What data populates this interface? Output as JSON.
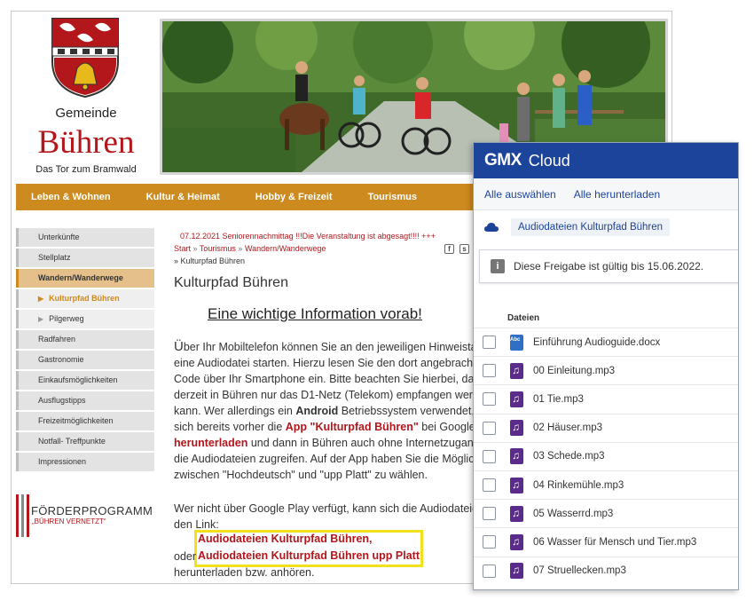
{
  "site": {
    "municipality_label": "Gemeinde",
    "municipality_name": "Bühren",
    "tagline": "Das Tor zum Bramwald",
    "nav": [
      "Leben & Wohnen",
      "Kultur & Heimat",
      "Hobby & Freizeit",
      "Tourismus"
    ],
    "sidebar": [
      {
        "label": "Unterkünfte",
        "state": "normal"
      },
      {
        "label": "Stellplatz",
        "state": "normal"
      },
      {
        "label": "Wandern/Wanderwege",
        "state": "active"
      },
      {
        "label": "Kulturpfad Bühren",
        "state": "sub-current"
      },
      {
        "label": "Pilgerweg",
        "state": "sub"
      },
      {
        "label": "Radfahren",
        "state": "normal"
      },
      {
        "label": "Gastronomie",
        "state": "normal"
      },
      {
        "label": "Einkaufsmöglichkeiten",
        "state": "normal"
      },
      {
        "label": "Ausflugstipps",
        "state": "normal"
      },
      {
        "label": "Freizeitmöglichkeiten",
        "state": "normal"
      },
      {
        "label": "Notfall- Treffpunkte",
        "state": "normal"
      },
      {
        "label": "Impressionen",
        "state": "normal"
      }
    ],
    "foerder_title": "FÖRDERPROGRAMM",
    "foerder_sub": "„BÜHREN VERNETZT“",
    "ticker": "07.12.2021 Seniorennachmittag !!!Die Veranstaltung ist abgesagt!!!!  +++",
    "breadcrumb": [
      "Start",
      "Tourismus",
      "Wandern/Wanderwege"
    ],
    "breadcrumb_current": "Kulturpfad Bühren",
    "page_title": "Kulturpfad Bühren",
    "subheading": "Eine wichtige Information vorab!",
    "para1": {
      "first_letter": "Ü",
      "l1": "ber Ihr Mobiltelefon können Sie an den jeweiligen Hinweistaf",
      "l2": "eine Audiodatei starten. Hierzu lesen Sie den dort angebrachte",
      "l3": "Code über Ihr Smartphone ein. Bitte beachten Sie hierbei, das",
      "l4": "derzeit in Bühren nur das D1-Netz (Telekom) empfangen werde",
      "l5a": "kann. Wer allerdings ein ",
      "l5b": "Android",
      "l5c": " Betriebssystem verwendet, k",
      "l6a": "sich bereits vorher die ",
      "l6b": "App \"Kulturpfad Bühren\"",
      "l6c": " bei  Google",
      "l7a": "herunterladen",
      "l7b": " und dann in Bühren auch ohne Internetzugang",
      "l8": "die Audiodateien zugreifen. Auf der App haben Sie die Möglich",
      "l9": "zwischen \"Hochdeutsch\" und \"upp Platt\" zu wählen."
    },
    "para2_l1": "Wer nicht über Google Play verfügt, kann sich die Audiodateien",
    "para2_l2": "den Link:",
    "link1": "Audiodateien Kulturpfad Bühren,",
    "oder": "oder",
    "link2": "Audiodateien Kulturpfad Bühren upp Platt",
    "para3": "herunterladen bzw. anhören."
  },
  "gmx": {
    "brand": "GMX",
    "product": "Cloud",
    "select_all": "Alle auswählen",
    "download_all": "Alle herunterladen",
    "folder": "Audiodateien Kulturpfad Bühren",
    "validity_note": "Diese Freigabe ist gültig bis 15.06.2022.",
    "files_label": "Dateien",
    "files": [
      {
        "name": "Einführung Audioguide.docx",
        "type": "doc"
      },
      {
        "name": "00 Einleitung.mp3",
        "type": "audio"
      },
      {
        "name": "01 Tie.mp3",
        "type": "audio"
      },
      {
        "name": "02 Häuser.mp3",
        "type": "audio"
      },
      {
        "name": "03 Schede.mp3",
        "type": "audio"
      },
      {
        "name": "04 Rinkemühle.mp3",
        "type": "audio"
      },
      {
        "name": "05 Wasserrd.mp3",
        "type": "audio"
      },
      {
        "name": "06 Wasser für Mensch und Tier.mp3",
        "type": "audio"
      },
      {
        "name": "07 Struellecken.mp3",
        "type": "audio"
      }
    ],
    "colors": {
      "header": "#1c449b",
      "audio_icon": "#5b2b8c",
      "doc_icon": "#2f6fc5"
    }
  }
}
